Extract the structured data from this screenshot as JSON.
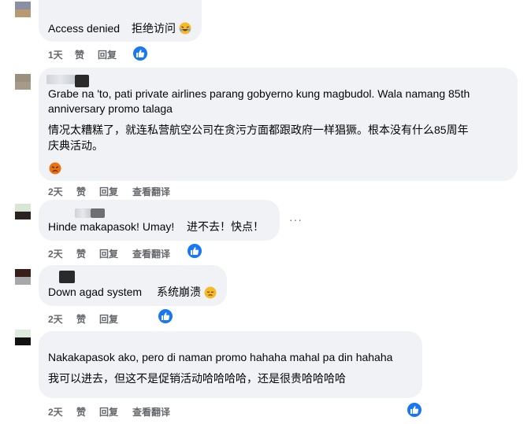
{
  "comments": [
    {
      "text": [
        "Access denied",
        "拒绝访问"
      ],
      "time": "1天",
      "like": "赞",
      "reply": "回复"
    },
    {
      "text": [
        "Grabe na 'to, pati private airlines parang gobyerno kung magbudol. Wala namang 85th",
        "anniversary promo talaga",
        "情况太糟糕了，就连私营航空公司在贪污方面都跟政府一样猖獗。根本没有什么85周年",
        "庆典活动。"
      ],
      "time": "2天",
      "like": "赞",
      "reply": "回复",
      "translate": "查看翻译"
    },
    {
      "text": [
        "Hinde makapasok! Umay!",
        "进不去！快点！"
      ],
      "time": "2天",
      "like": "赞",
      "reply": "回复",
      "translate": "查看翻译",
      "more": "···"
    },
    {
      "text": [
        "Down agad system",
        "系统崩溃"
      ],
      "time": "2天",
      "like": "赞",
      "reply": "回复"
    },
    {
      "text": [
        "Nakakapasok ako, pero di naman promo hahaha mahal pa din hahaha",
        "我可以进去，但这不是促销活动哈哈哈哈，还是很贵哈哈哈哈"
      ],
      "time": "2天",
      "like": "赞",
      "reply": "回复",
      "translate": "查看翻译"
    }
  ],
  "colors": {
    "bubble": "#f0f2f5",
    "meta": "#65676b",
    "like_badge": "#1877f2"
  },
  "icons": [
    "thumbs-up-icon",
    "laughing-emoji-icon",
    "angry-emoji-icon",
    "weary-emoji-icon",
    "more-options-icon"
  ]
}
